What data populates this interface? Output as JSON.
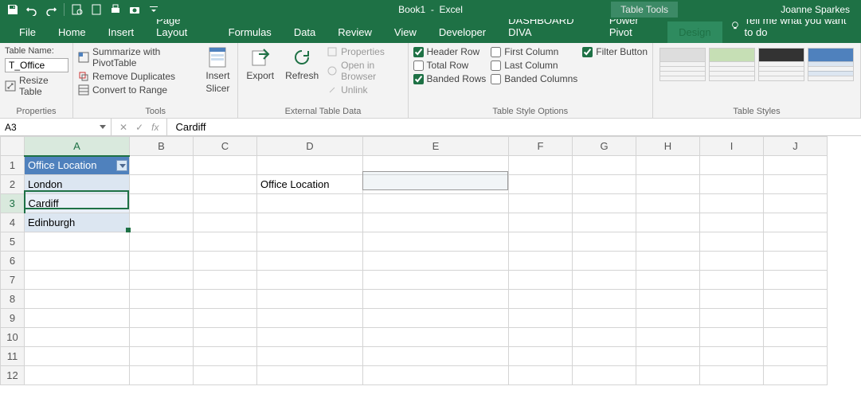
{
  "title": {
    "doc": "Book1",
    "app": "Excel",
    "tool_tab": "Table Tools",
    "user": "Joanne Sparkes"
  },
  "tabs": [
    "File",
    "Home",
    "Insert",
    "Page Layout",
    "Formulas",
    "Data",
    "Review",
    "View",
    "Developer",
    "DASHBOARD DIVA",
    "Power Pivot",
    "Design"
  ],
  "tellme": "Tell me what you want to do",
  "ribbon": {
    "properties": {
      "label": "Properties",
      "name_label": "Table Name:",
      "name_value": "T_Office",
      "resize": "Resize Table"
    },
    "tools": {
      "label": "Tools",
      "pivot": "Summarize with PivotTable",
      "dups": "Remove Duplicates",
      "range": "Convert to Range",
      "slicer": "Slicer",
      "insert": "Insert"
    },
    "external": {
      "label": "External Table Data",
      "export": "Export",
      "refresh": "Refresh",
      "props": "Properties",
      "browser": "Open in Browser",
      "unlink": "Unlink"
    },
    "options": {
      "label": "Table Style Options",
      "header_row": "Header Row",
      "total_row": "Total Row",
      "banded_rows": "Banded Rows",
      "first_col": "First Column",
      "last_col": "Last Column",
      "banded_cols": "Banded Columns",
      "filter": "Filter Button",
      "checked": {
        "header_row": true,
        "total_row": false,
        "banded_rows": true,
        "first_col": false,
        "last_col": false,
        "banded_cols": false,
        "filter": true
      }
    },
    "styles": {
      "label": "Table Styles"
    }
  },
  "formula_bar": {
    "name_box": "A3",
    "fx": "fx",
    "value": "Cardiff"
  },
  "columns": [
    "A",
    "B",
    "C",
    "D",
    "E",
    "F",
    "G",
    "H",
    "I",
    "J"
  ],
  "rows": [
    1,
    2,
    3,
    4,
    5,
    6,
    7,
    8,
    9,
    10,
    11,
    12
  ],
  "cells": {
    "A1": "Office Location",
    "A2": "London",
    "A3": "Cardiff",
    "A4": "Edinburgh",
    "D2": "Office Location"
  },
  "col_widths": {
    "hdr": 30,
    "A": 132,
    "B": 80,
    "C": 80,
    "D": 133,
    "E": 183,
    "F": 80,
    "G": 80,
    "H": 80,
    "I": 80,
    "J": 80
  },
  "active_cell": "A3",
  "secondary_sel": "E2"
}
